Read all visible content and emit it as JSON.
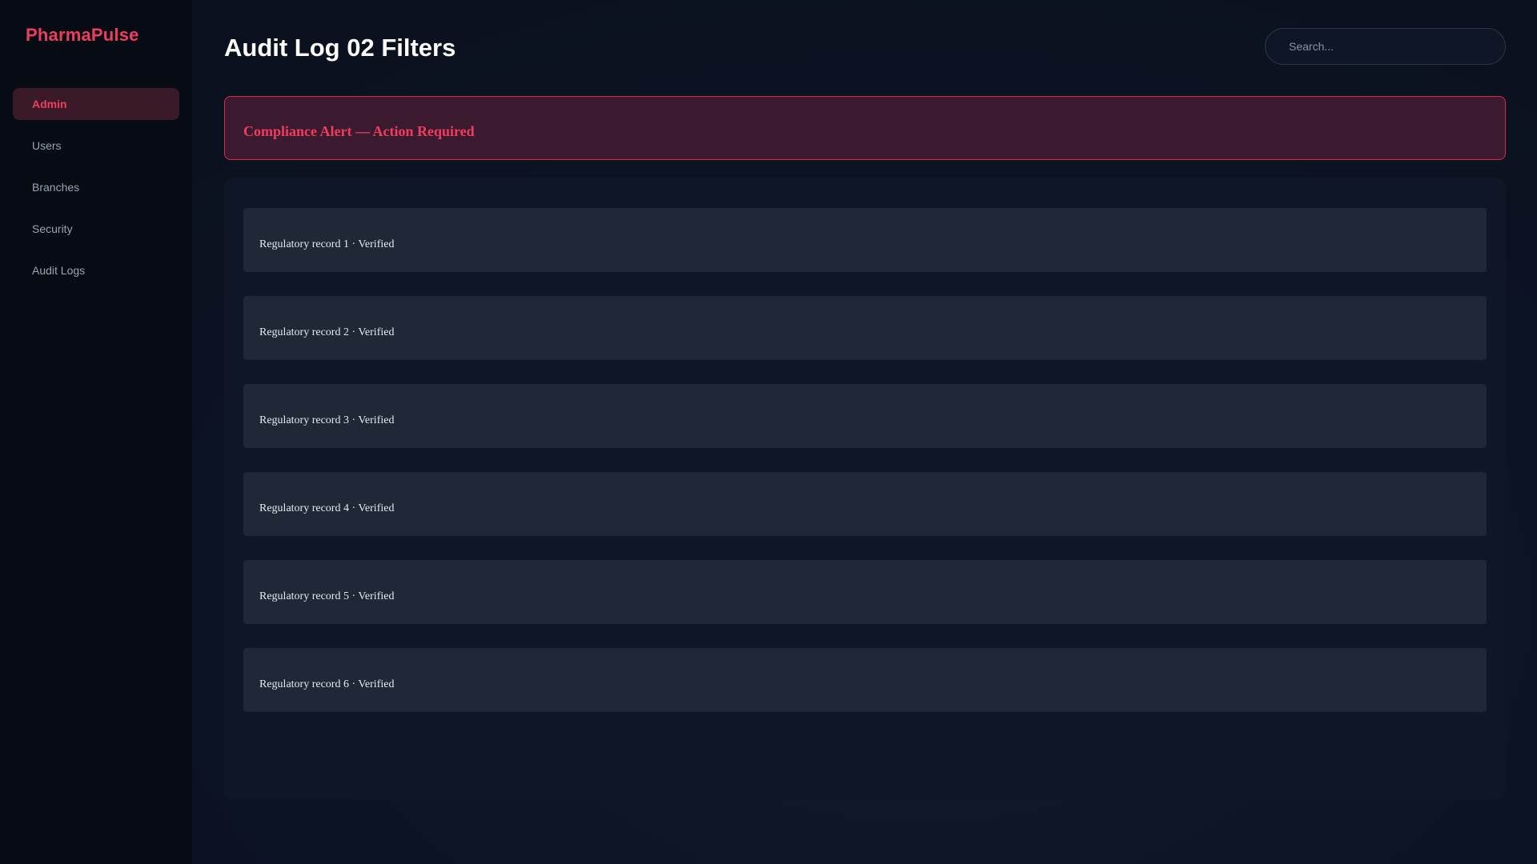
{
  "sidebar": {
    "brand": "PharmaPulse",
    "items": [
      {
        "label": "Admin",
        "active": true
      },
      {
        "label": "Users",
        "active": false
      },
      {
        "label": "Branches",
        "active": false
      },
      {
        "label": "Security",
        "active": false
      },
      {
        "label": "Audit Logs",
        "active": false
      }
    ]
  },
  "header": {
    "title": "Audit Log 02 Filters",
    "search_placeholder": "Search..."
  },
  "alert": {
    "text": "Compliance Alert — Action Required"
  },
  "records": [
    {
      "text": "Regulatory record 1 · Verified"
    },
    {
      "text": "Regulatory record 2 · Verified"
    },
    {
      "text": "Regulatory record 3 · Verified"
    },
    {
      "text": "Regulatory record 4 · Verified"
    },
    {
      "text": "Regulatory record 5 · Verified"
    },
    {
      "text": "Regulatory record 6 · Verified"
    }
  ],
  "colors": {
    "accent": "#ef3d5f",
    "sidebar_bg": "#070b14",
    "alert_bg": "#3b1a30",
    "alert_border": "#d12a4d",
    "record_bg": "#1f2837"
  }
}
